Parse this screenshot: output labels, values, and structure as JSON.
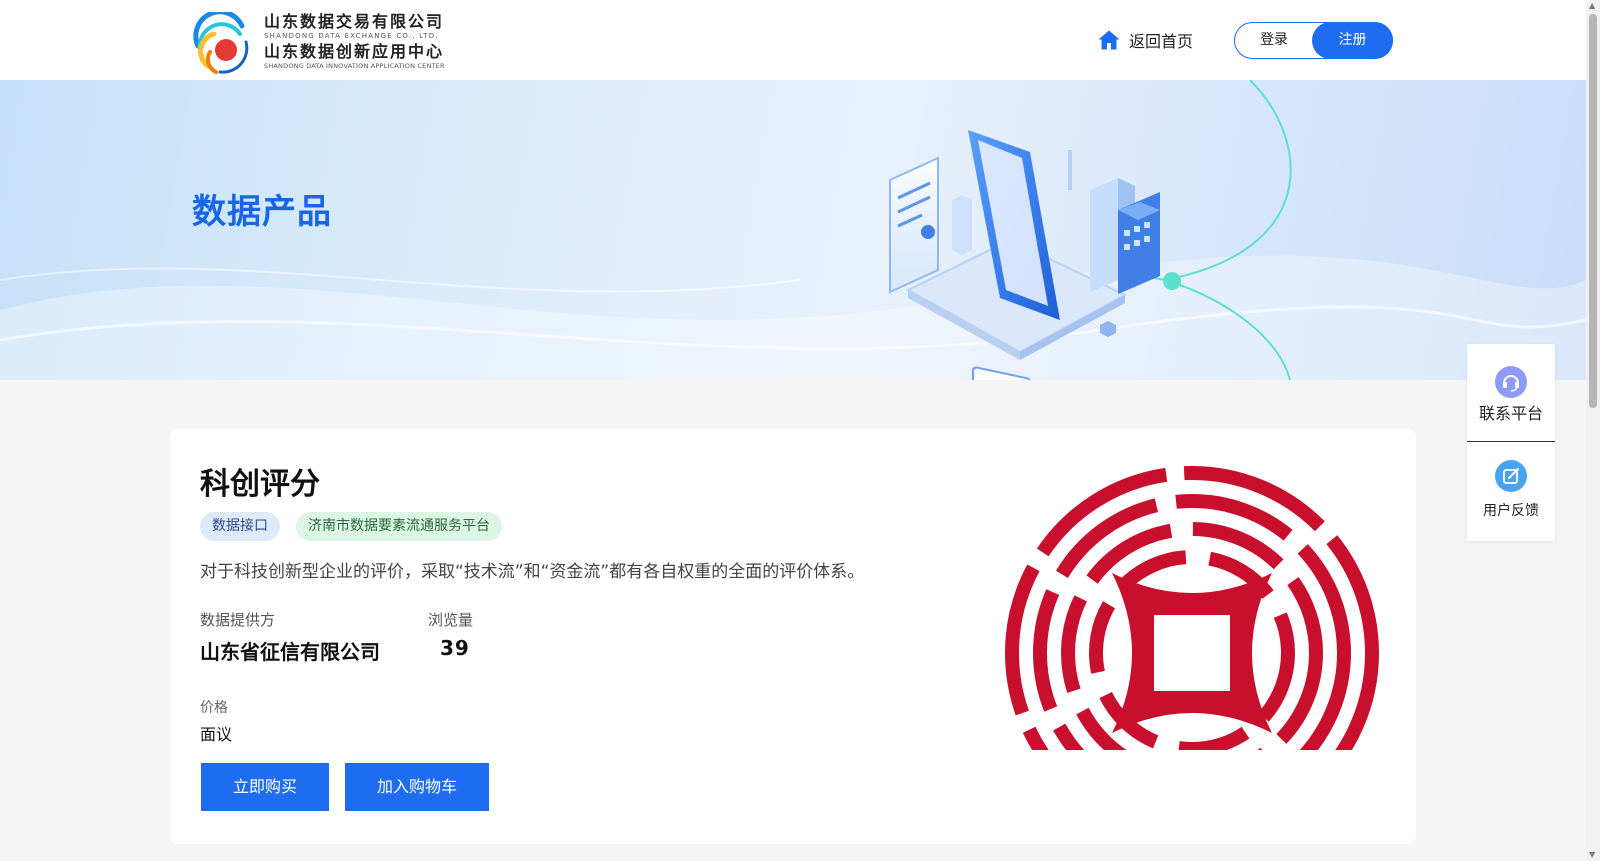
{
  "header": {
    "logo": {
      "cn_line1": "山东数据交易有限公司",
      "en_line1": "SHANDONG DATA EXCHANGE CO., LTD.",
      "cn_line2": "山东数据创新应用中心",
      "en_line2": "SHANDONG DATA INNOVATION APPLICATION CENTER"
    },
    "home_label": "返回首页",
    "login_label": "登录",
    "register_label": "注册"
  },
  "banner": {
    "title": "数据产品"
  },
  "product": {
    "title": "科创评分",
    "tags": [
      "数据接口",
      "济南市数据要素流通服务平台"
    ],
    "description": "对于科技创新型企业的评价，采取“技术流”和“资金流”都有各自权重的全面的评价体系。",
    "provider_label": "数据提供方",
    "provider_value": "山东省征信有限公司",
    "views_label": "浏览量",
    "views_value": "39",
    "price_label": "价格",
    "price_value": "面议",
    "buy_label": "立即购买",
    "cart_label": "加入购物车"
  },
  "side_panel": {
    "contact_label": "联系平台",
    "feedback_label": "用户反馈"
  },
  "colors": {
    "accent": "#1e6cf0",
    "banner_title": "#1766e8",
    "product_logo_red": "#c8102e"
  }
}
